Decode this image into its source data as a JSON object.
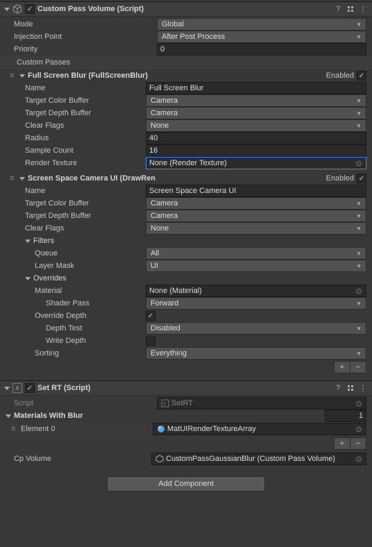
{
  "comp1": {
    "title": "Custom Pass Volume (Script)",
    "mode": {
      "label": "Mode",
      "value": "Global"
    },
    "injection": {
      "label": "Injection Point",
      "value": "After Post Process"
    },
    "priority": {
      "label": "Priority",
      "value": "0"
    },
    "customPassesLabel": "Custom Passes",
    "pass1": {
      "title": "Full Screen Blur (FullScreenBlur)",
      "enabledLabel": "Enabled",
      "name": {
        "label": "Name",
        "value": "Full Screen Blur"
      },
      "tcb": {
        "label": "Target Color Buffer",
        "value": "Camera"
      },
      "tdb": {
        "label": "Target Depth Buffer",
        "value": "Camera"
      },
      "cf": {
        "label": "Clear Flags",
        "value": "None"
      },
      "radius": {
        "label": "Radius",
        "value": "40"
      },
      "samples": {
        "label": "Sample Count",
        "value": "16"
      },
      "rt": {
        "label": "Render Texture",
        "value": "None (Render Texture)"
      }
    },
    "pass2": {
      "title": "Screen Space Camera UI (DrawRen",
      "enabledLabel": "Enabled",
      "name": {
        "label": "Name",
        "value": "Screen Space Camera UI"
      },
      "tcb": {
        "label": "Target Color Buffer",
        "value": "Camera"
      },
      "tdb": {
        "label": "Target Depth Buffer",
        "value": "Camera"
      },
      "cf": {
        "label": "Clear Flags",
        "value": "None"
      },
      "filtersLabel": "Filters",
      "queue": {
        "label": "Queue",
        "value": "All"
      },
      "layerMask": {
        "label": "Layer Mask",
        "value": "UI"
      },
      "overridesLabel": "Overrides",
      "material": {
        "label": "Material",
        "value": "None (Material)"
      },
      "shaderPass": {
        "label": "Shader Pass",
        "value": "Forward"
      },
      "overrideDepth": {
        "label": "Override Depth"
      },
      "depthTest": {
        "label": "Depth Test",
        "value": "Disabled"
      },
      "writeDepth": {
        "label": "Write Depth"
      },
      "sorting": {
        "label": "Sorting",
        "value": "Everything"
      }
    }
  },
  "comp2": {
    "title": "Set RT (Script)",
    "script": {
      "label": "Script",
      "value": "SetRT"
    },
    "materialsLabel": "Materials With Blur",
    "materialsCount": "1",
    "element0": {
      "label": "Element 0",
      "value": "MatUIRenderTextureArray"
    },
    "cpVolume": {
      "label": "Cp Volume",
      "value": "CustomPassGaussianBlur (Custom Pass Volume)"
    }
  },
  "addComponent": "Add Component",
  "icons": {
    "plus": "+",
    "minus": "−"
  }
}
